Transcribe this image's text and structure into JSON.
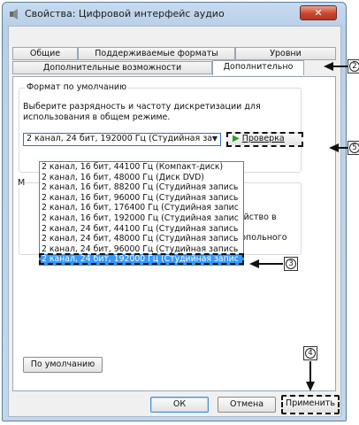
{
  "window": {
    "title": "Свойства: Цифровой интерфейс аудио",
    "close_label": "✕"
  },
  "tabs": {
    "row1": [
      "Общие",
      "Поддерживаемые форматы",
      "Уровни"
    ],
    "row2": [
      "Дополнительные возможности",
      "Дополнительно"
    ],
    "active": "Дополнительно"
  },
  "default_format": {
    "group_title": "Формат по умолчанию",
    "description": "Выберите разрядность и частоту дискретизации для использования в общем режиме.",
    "selected_value": "2 канал, 24 бит, 192000 Гц (Студийная за",
    "test_button": "Проверка"
  },
  "dropdown_options": [
    "2 канал, 16 бит, 44100 Гц (Компакт-диск)",
    "2 канал, 16 бит, 48000 Гц (Диск DVD)",
    "2 канал, 16 бит, 88200 Гц (Студийная запись",
    "2 канал, 16 бит, 96000 Гц (Студийная запись",
    "2 канал, 16 бит, 176400 Гц (Студийная запис",
    "2 канал, 16 бит, 192000 Гц (Студийная запис",
    "2 канал, 24 бит, 44100 Гц (Студийная запись",
    "2 канал, 24 бит, 48000 Гц (Студийная запись",
    "2 канал, 24 бит, 96000 Гц (Студийная запись",
    "2 канал, 24 бит, 192000 Гц (Студийная запис"
  ],
  "selected_option_index": 9,
  "partial_text": {
    "left_letter": "М",
    "line1": "стройство в",
    "line2": "монопольного"
  },
  "buttons": {
    "defaults": "По умолчанию",
    "ok": "ОК",
    "cancel": "Отмена",
    "apply": "Применить"
  },
  "callouts": {
    "c2": "2",
    "c3": "3",
    "c4": "4",
    "c5": "5"
  },
  "colors": {
    "selection": "#3399ff",
    "close": "#c9452f",
    "play": "#2aa022"
  }
}
